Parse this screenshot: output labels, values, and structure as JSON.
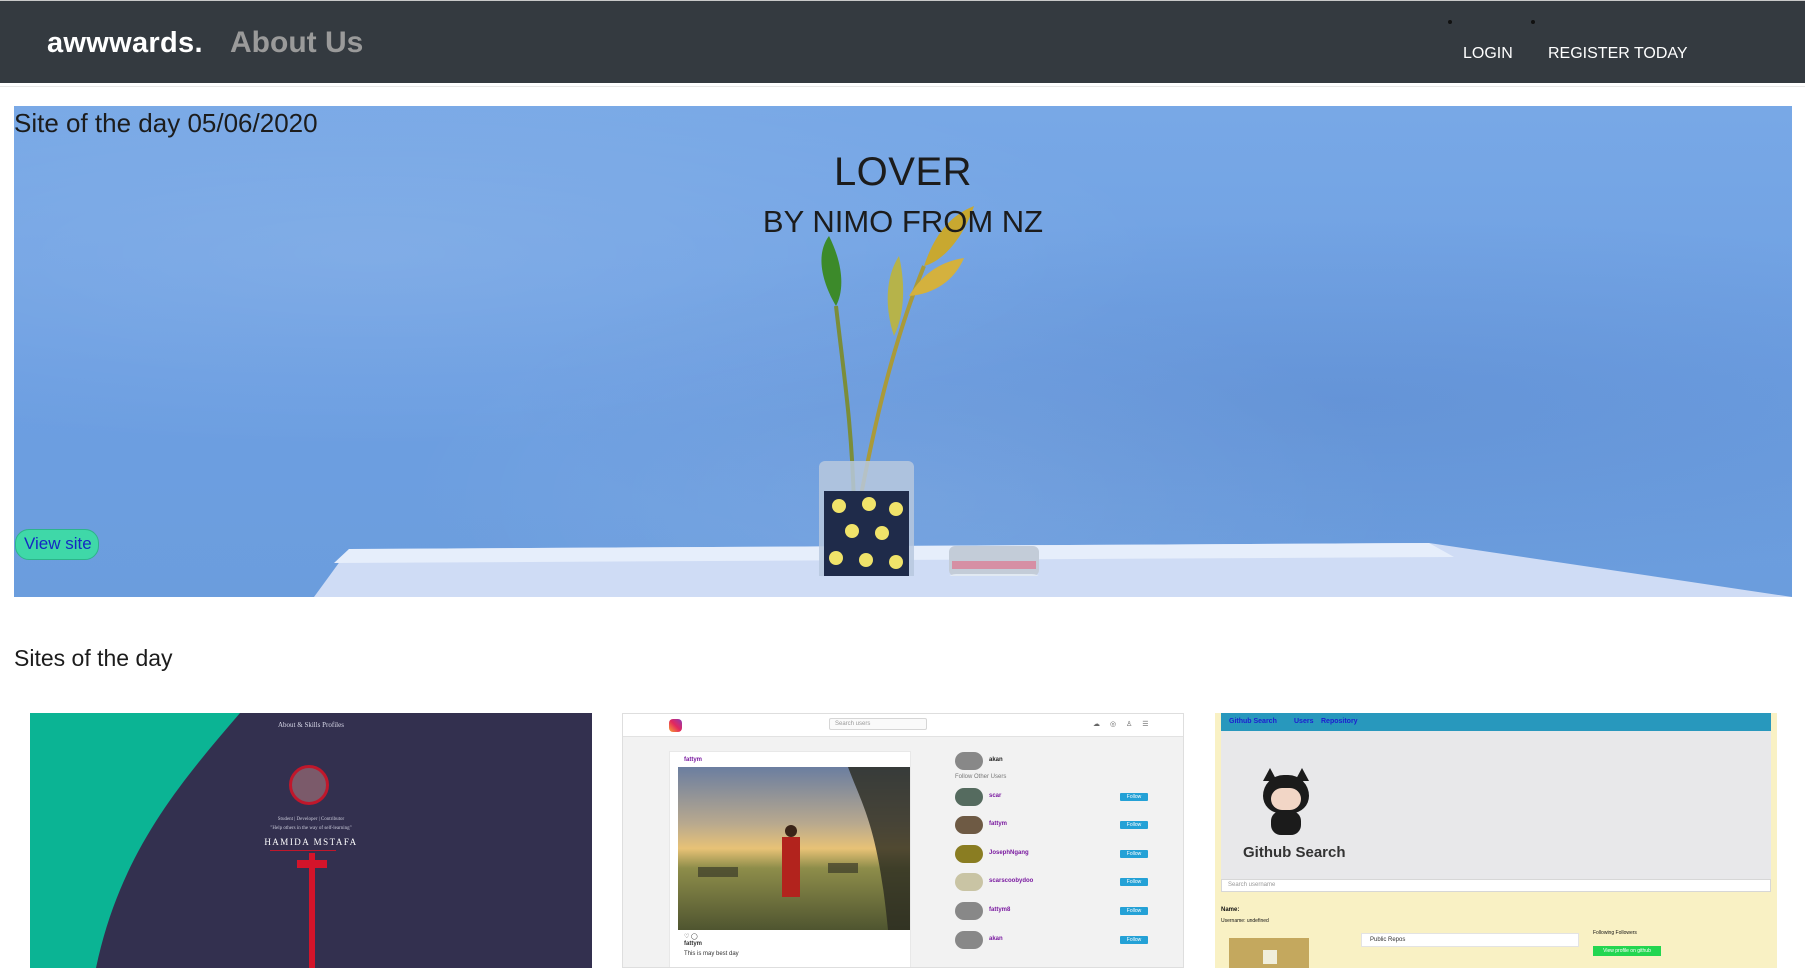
{
  "nav": {
    "brand": "awwwards.",
    "about": "About Us",
    "login": "LOGIN",
    "register": "REGISTER TODAY"
  },
  "hero": {
    "date_label": "Site of the day 05/06/2020",
    "title": "LOVER",
    "subtitle": "BY NIMO FROM NZ",
    "view_button": "View site",
    "wall_color": "#76a6e4"
  },
  "sites_section": {
    "title": "Sites of the day"
  },
  "cards": [
    {
      "nav": "About & Skills   Profiles",
      "tagline": "Student | Developer | Contributor",
      "quote": "\"Help others in the way of self-learning\"",
      "name": "HAMIDA MSTAFA",
      "accent": "#d4142a",
      "teal": "#0bb494"
    },
    {
      "search_placeholder": "Search users",
      "post_user": "fattym",
      "post_author": "fattym",
      "post_caption": "This is may best day",
      "likes_icons": "♡ ◯",
      "side_user": "akan",
      "follow_label": "Follow Other Users",
      "follow_button": "Follow",
      "users": [
        "scar",
        "fattym",
        "JosephNgang",
        "scarscoobydoo",
        "fattym8",
        "akan"
      ]
    },
    {
      "nav_title": "Github Search",
      "nav_users": "Users",
      "nav_repo": "Repository",
      "title": "Github Search",
      "search_placeholder": "Search username",
      "name_label": "Name:",
      "username_label": "Username: undefined",
      "public_repos": "Public Repos",
      "following": "Following Followers",
      "github_button": "View profile on github"
    }
  ]
}
